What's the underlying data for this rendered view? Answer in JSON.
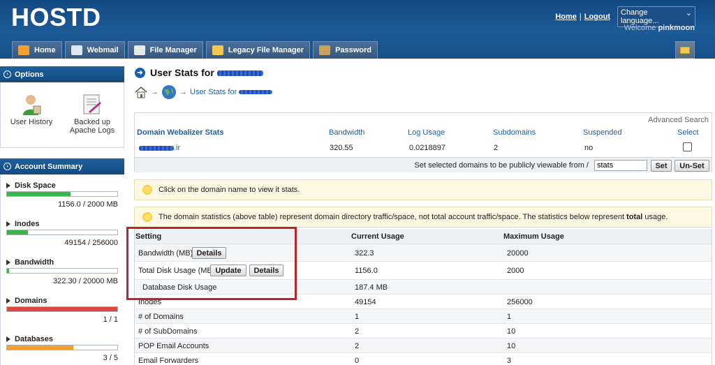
{
  "header": {
    "logo": "HOSTD",
    "home_link": "Home",
    "separator": "|",
    "logout_link": "Logout",
    "language_select": "Change language...",
    "welcome_prefix": "Welcome",
    "username": "pinkmoon"
  },
  "nav": {
    "tabs": [
      {
        "label": "Home",
        "icon": "home-icon",
        "color": "#f0a030"
      },
      {
        "label": "Webmail",
        "icon": "envelope-icon",
        "color": "#dfe7f2"
      },
      {
        "label": "File Manager",
        "icon": "file-manager-icon",
        "color": "#e8e8e8"
      },
      {
        "label": "Legacy File Manager",
        "icon": "folder-icon",
        "color": "#f2c94c"
      },
      {
        "label": "Password",
        "icon": "key-icon",
        "color": "#c9a060"
      }
    ]
  },
  "sidebar": {
    "options_title": "Options",
    "options": [
      {
        "label_line1": "User History",
        "label_line2": "",
        "icon": "user-icon"
      },
      {
        "label_line1": "Backed up",
        "label_line2": "Apache Logs",
        "icon": "logs-icon"
      }
    ],
    "summary_title": "Account Summary",
    "summary": [
      {
        "title": "Disk Space",
        "value": "1156.0 / 2000 MB",
        "fraction": 0.578,
        "color": "#3bb54a"
      },
      {
        "title": "Inodes",
        "value": "49154 / 256000",
        "fraction": 0.192,
        "color": "#3bb54a"
      },
      {
        "title": "Bandwidth",
        "value": "322.30 / 20000 MB",
        "fraction": 0.016,
        "color": "#3bb54a"
      },
      {
        "title": "Domains",
        "value": "1 / 1",
        "fraction": 1.0,
        "color": "#e0463c"
      },
      {
        "title": "Databases",
        "value": "3 / 5",
        "fraction": 0.6,
        "color": "#f0a030"
      }
    ]
  },
  "main": {
    "title": "User Stats for",
    "breadcrumb_arrow": "→",
    "breadcrumb_current": "User Stats for",
    "domains_table": {
      "advanced_search": "Advanced Search",
      "headers": [
        "Domain Webalizer Stats",
        "Bandwidth",
        "Log Usage",
        "Subdomains",
        "Suspended",
        "Select"
      ],
      "row": {
        "domain_suffix": ".ir",
        "bandwidth": "320.55",
        "log_usage": "0.0218897",
        "subdomains": "2",
        "suspended": "no"
      },
      "public_text": "Set selected domains to be publicly viewable from /",
      "stats_value": "stats",
      "set_button": "Set",
      "unset_button": "Un-Set"
    },
    "notice1": "Click on the domain name to view it stats.",
    "notice2_pre": "The domain statistics (above table) represent domain directory traffic/space, not total account traffic/space. The statistics below represent",
    "notice2_bold": "total",
    "notice2_post": "usage.",
    "usage": {
      "headers": [
        "Setting",
        "Current Usage",
        "Maximum Usage"
      ],
      "details_button": "Details",
      "update_button": "Update",
      "rows": [
        {
          "setting": "Bandwidth (MB)",
          "current": "322.3",
          "max": "20000"
        },
        {
          "setting": "Total Disk Usage (MB)",
          "current": "1156.0",
          "max": "2000"
        },
        {
          "setting": "Database Disk Usage",
          "current": "187.4 MB",
          "max": ""
        },
        {
          "setting": "Inodes",
          "current": "49154",
          "max": "256000"
        },
        {
          "setting": "# of Domains",
          "current": "1",
          "max": "1"
        },
        {
          "setting": "# of SubDomains",
          "current": "2",
          "max": "10"
        },
        {
          "setting": "POP Email Accounts",
          "current": "2",
          "max": "10"
        },
        {
          "setting": "Email Forwarders",
          "current": "0",
          "max": "3"
        }
      ]
    }
  }
}
